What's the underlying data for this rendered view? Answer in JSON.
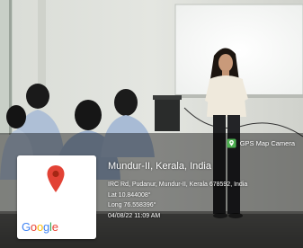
{
  "watermark": {
    "brand_label": "GPS Map Camera",
    "brand_icon": "map-pin-camera-icon"
  },
  "map": {
    "pin_icon": "location-pin-icon",
    "pin_color": "#e24235",
    "logo": {
      "letters": [
        "G",
        "o",
        "o",
        "g",
        "l",
        "e"
      ],
      "colors": [
        "#4285F4",
        "#EA4335",
        "#FBBC05",
        "#4285F4",
        "#34A853",
        "#EA4335"
      ]
    }
  },
  "location": {
    "title": "Mundur-II, Kerala, India",
    "address": "IRC Rd, Pudanur, Mundur-II, Kerala 678592, India",
    "lat": "Lat 10.844008°",
    "long": "Long 76.558396°",
    "datetime": "04/08/22 11:09 AM"
  }
}
